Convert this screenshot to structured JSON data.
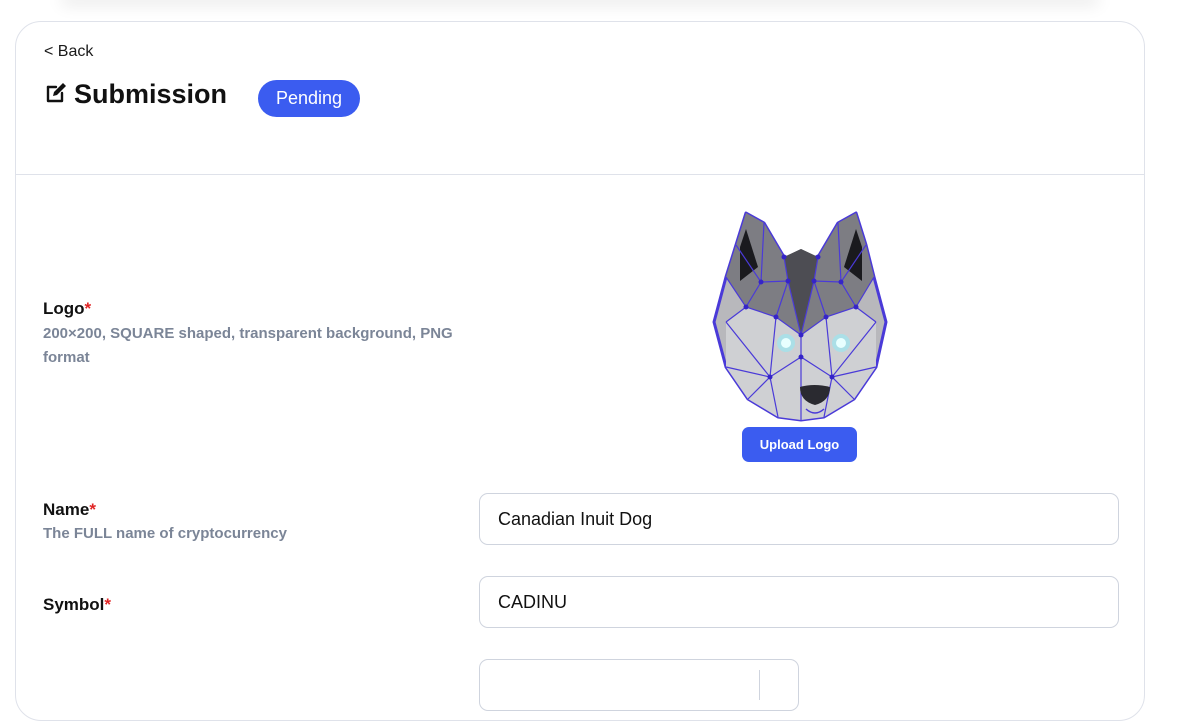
{
  "header": {
    "back_label": "< Back",
    "title": "Submission",
    "status": "Pending"
  },
  "fields": {
    "logo": {
      "label": "Logo",
      "required_mark": "*",
      "hint": "200×200, SQUARE shaped, transparent background, PNG format",
      "upload_label": "Upload Logo"
    },
    "name": {
      "label": "Name",
      "required_mark": "*",
      "hint": "The FULL name of cryptocurrency",
      "value": "Canadian Inuit Dog"
    },
    "symbol": {
      "label": "Symbol",
      "required_mark": "*",
      "value": "CADINU"
    }
  },
  "icons": {
    "edit": "edit-icon",
    "logo": "husky-logo"
  },
  "colors": {
    "accent": "#3b5cf0",
    "required": "#e02424",
    "hint": "#7b8597",
    "border": "#dfe2ea"
  }
}
